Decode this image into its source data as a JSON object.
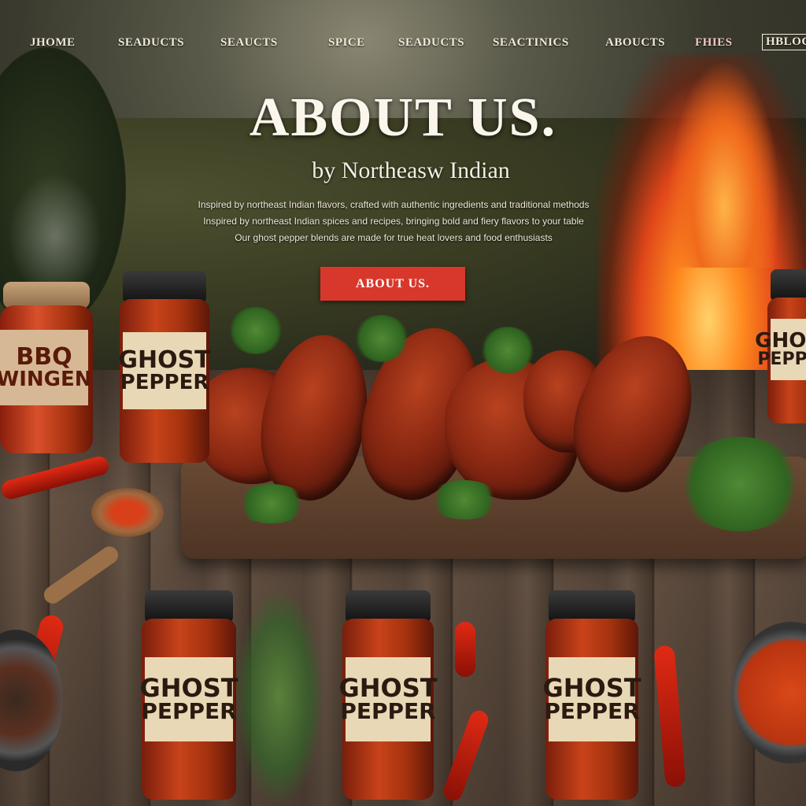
{
  "nav": {
    "items": [
      "JHOME",
      "SEADUCTS",
      "SEAUCTS",
      "SPICE",
      "SEADUCTS",
      "SEACTINICS",
      "ABOUCTS",
      "FHIES",
      "HBLOGE"
    ]
  },
  "hero": {
    "title": "ABOUT US.",
    "subtitle": "by Northeasw Indian",
    "description_lines": [
      "Inspired by northeast Indian flavors, crafted with authentic ingredients and traditional methods",
      "Inspired by northeast Indian spices and recipes, bringing bold and fiery flavors to your table",
      "Our ghost pepper blends are made for true heat lovers and food enthusiasts"
    ],
    "cta_label": "ABOUT US."
  },
  "products": {
    "bbq_jar_label_line1": "BBQ",
    "bbq_jar_label_line2": "WINGEN",
    "jar_label_line1": "GHOST",
    "jar_label_line2": "PEPPER",
    "jar_alt_label_line2": "PEPPER"
  },
  "colors": {
    "cta_background": "#d8382c",
    "nav_text": "#f2ead8",
    "title_text": "#fbf6ec"
  }
}
